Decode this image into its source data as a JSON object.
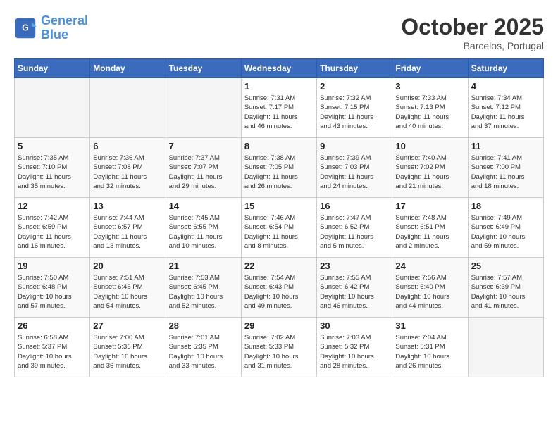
{
  "header": {
    "logo_line1": "General",
    "logo_line2": "Blue",
    "month": "October 2025",
    "location": "Barcelos, Portugal"
  },
  "days_of_week": [
    "Sunday",
    "Monday",
    "Tuesday",
    "Wednesday",
    "Thursday",
    "Friday",
    "Saturday"
  ],
  "weeks": [
    [
      {
        "day": "",
        "info": ""
      },
      {
        "day": "",
        "info": ""
      },
      {
        "day": "",
        "info": ""
      },
      {
        "day": "1",
        "info": "Sunrise: 7:31 AM\nSunset: 7:17 PM\nDaylight: 11 hours\nand 46 minutes."
      },
      {
        "day": "2",
        "info": "Sunrise: 7:32 AM\nSunset: 7:15 PM\nDaylight: 11 hours\nand 43 minutes."
      },
      {
        "day": "3",
        "info": "Sunrise: 7:33 AM\nSunset: 7:13 PM\nDaylight: 11 hours\nand 40 minutes."
      },
      {
        "day": "4",
        "info": "Sunrise: 7:34 AM\nSunset: 7:12 PM\nDaylight: 11 hours\nand 37 minutes."
      }
    ],
    [
      {
        "day": "5",
        "info": "Sunrise: 7:35 AM\nSunset: 7:10 PM\nDaylight: 11 hours\nand 35 minutes."
      },
      {
        "day": "6",
        "info": "Sunrise: 7:36 AM\nSunset: 7:08 PM\nDaylight: 11 hours\nand 32 minutes."
      },
      {
        "day": "7",
        "info": "Sunrise: 7:37 AM\nSunset: 7:07 PM\nDaylight: 11 hours\nand 29 minutes."
      },
      {
        "day": "8",
        "info": "Sunrise: 7:38 AM\nSunset: 7:05 PM\nDaylight: 11 hours\nand 26 minutes."
      },
      {
        "day": "9",
        "info": "Sunrise: 7:39 AM\nSunset: 7:03 PM\nDaylight: 11 hours\nand 24 minutes."
      },
      {
        "day": "10",
        "info": "Sunrise: 7:40 AM\nSunset: 7:02 PM\nDaylight: 11 hours\nand 21 minutes."
      },
      {
        "day": "11",
        "info": "Sunrise: 7:41 AM\nSunset: 7:00 PM\nDaylight: 11 hours\nand 18 minutes."
      }
    ],
    [
      {
        "day": "12",
        "info": "Sunrise: 7:42 AM\nSunset: 6:59 PM\nDaylight: 11 hours\nand 16 minutes."
      },
      {
        "day": "13",
        "info": "Sunrise: 7:44 AM\nSunset: 6:57 PM\nDaylight: 11 hours\nand 13 minutes."
      },
      {
        "day": "14",
        "info": "Sunrise: 7:45 AM\nSunset: 6:55 PM\nDaylight: 11 hours\nand 10 minutes."
      },
      {
        "day": "15",
        "info": "Sunrise: 7:46 AM\nSunset: 6:54 PM\nDaylight: 11 hours\nand 8 minutes."
      },
      {
        "day": "16",
        "info": "Sunrise: 7:47 AM\nSunset: 6:52 PM\nDaylight: 11 hours\nand 5 minutes."
      },
      {
        "day": "17",
        "info": "Sunrise: 7:48 AM\nSunset: 6:51 PM\nDaylight: 11 hours\nand 2 minutes."
      },
      {
        "day": "18",
        "info": "Sunrise: 7:49 AM\nSunset: 6:49 PM\nDaylight: 10 hours\nand 59 minutes."
      }
    ],
    [
      {
        "day": "19",
        "info": "Sunrise: 7:50 AM\nSunset: 6:48 PM\nDaylight: 10 hours\nand 57 minutes."
      },
      {
        "day": "20",
        "info": "Sunrise: 7:51 AM\nSunset: 6:46 PM\nDaylight: 10 hours\nand 54 minutes."
      },
      {
        "day": "21",
        "info": "Sunrise: 7:53 AM\nSunset: 6:45 PM\nDaylight: 10 hours\nand 52 minutes."
      },
      {
        "day": "22",
        "info": "Sunrise: 7:54 AM\nSunset: 6:43 PM\nDaylight: 10 hours\nand 49 minutes."
      },
      {
        "day": "23",
        "info": "Sunrise: 7:55 AM\nSunset: 6:42 PM\nDaylight: 10 hours\nand 46 minutes."
      },
      {
        "day": "24",
        "info": "Sunrise: 7:56 AM\nSunset: 6:40 PM\nDaylight: 10 hours\nand 44 minutes."
      },
      {
        "day": "25",
        "info": "Sunrise: 7:57 AM\nSunset: 6:39 PM\nDaylight: 10 hours\nand 41 minutes."
      }
    ],
    [
      {
        "day": "26",
        "info": "Sunrise: 6:58 AM\nSunset: 5:37 PM\nDaylight: 10 hours\nand 39 minutes."
      },
      {
        "day": "27",
        "info": "Sunrise: 7:00 AM\nSunset: 5:36 PM\nDaylight: 10 hours\nand 36 minutes."
      },
      {
        "day": "28",
        "info": "Sunrise: 7:01 AM\nSunset: 5:35 PM\nDaylight: 10 hours\nand 33 minutes."
      },
      {
        "day": "29",
        "info": "Sunrise: 7:02 AM\nSunset: 5:33 PM\nDaylight: 10 hours\nand 31 minutes."
      },
      {
        "day": "30",
        "info": "Sunrise: 7:03 AM\nSunset: 5:32 PM\nDaylight: 10 hours\nand 28 minutes."
      },
      {
        "day": "31",
        "info": "Sunrise: 7:04 AM\nSunset: 5:31 PM\nDaylight: 10 hours\nand 26 minutes."
      },
      {
        "day": "",
        "info": ""
      }
    ]
  ]
}
